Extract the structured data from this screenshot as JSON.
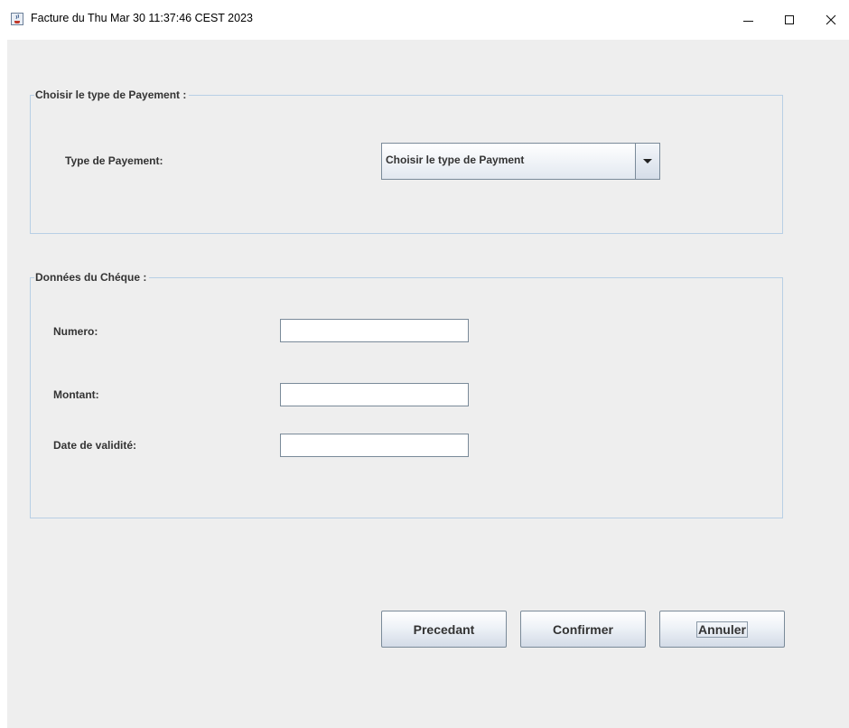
{
  "window": {
    "title": "Facture du  Thu Mar 30 11:37:46 CEST 2023",
    "icon": "java-coffee-icon",
    "controls": {
      "minimize": "minimize-icon",
      "maximize": "maximize-icon",
      "close": "close-icon"
    }
  },
  "payment_group": {
    "legend": "Choisir le type de Payement :",
    "type_label": "Type de Payement:",
    "combo": {
      "selected": "Choisir le type de Payment",
      "arrow_icon": "chevron-down-icon"
    }
  },
  "cheque_group": {
    "legend": "Données du Chéque :",
    "fields": [
      {
        "label": "Numero:",
        "value": ""
      },
      {
        "label": "Montant:",
        "value": ""
      },
      {
        "label": "Date de validité:",
        "value": ""
      }
    ]
  },
  "buttons": {
    "previous": "Precedant",
    "confirm": "Confirmer",
    "cancel": "Annuler"
  },
  "colors": {
    "panel_background": "#eeeeee",
    "group_border": "#b8cfe5",
    "text": "#333333"
  }
}
